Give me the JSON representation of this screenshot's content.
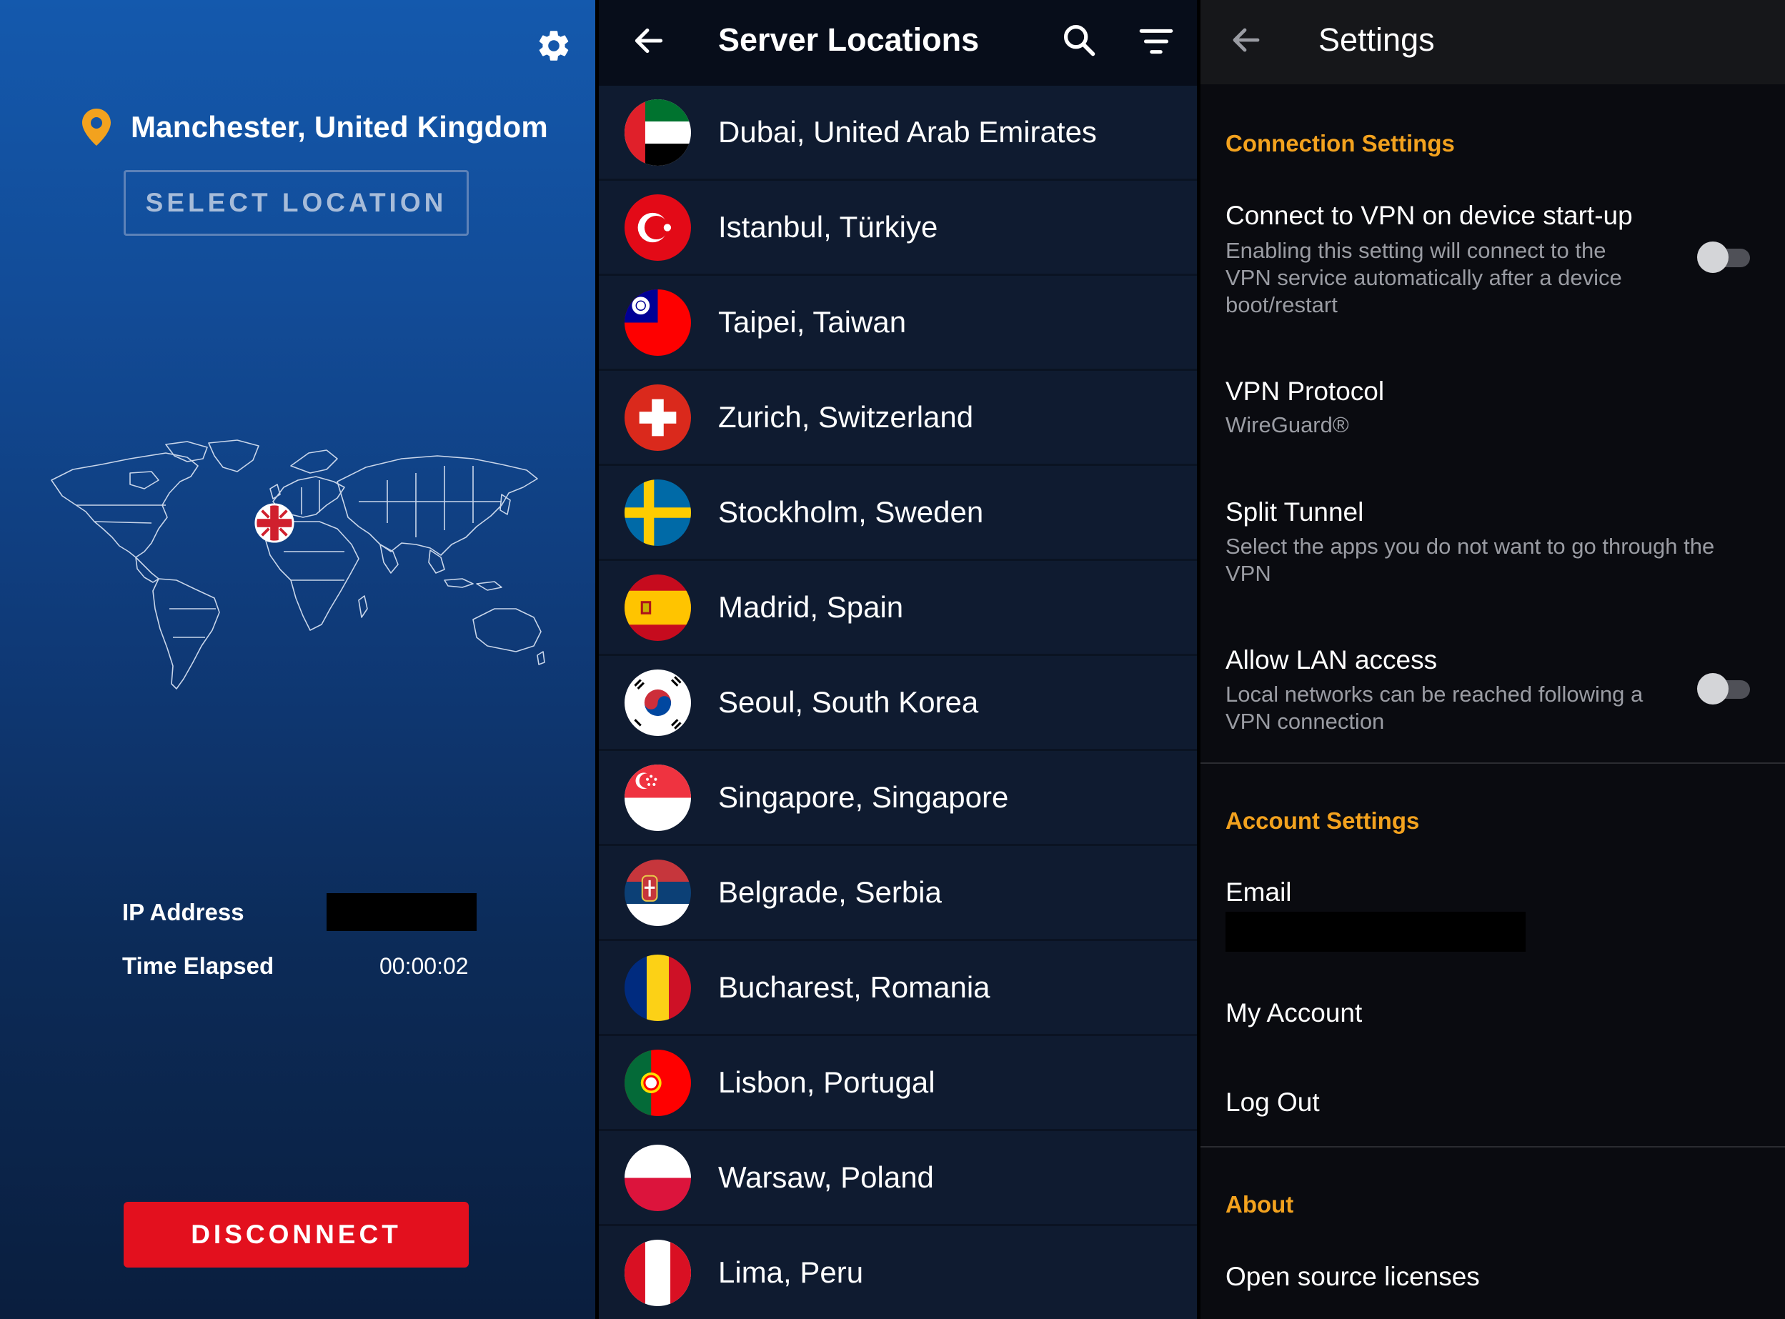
{
  "home": {
    "location": "Manchester, United Kingdom",
    "select_location": "SELECT LOCATION",
    "ip_label": "IP Address",
    "time_label": "Time Elapsed",
    "time_value": "00:00:02",
    "disconnect": "DISCONNECT",
    "colors": {
      "accent_red": "#e3101e",
      "pin": "#f3a21e"
    }
  },
  "servers": {
    "title": "Server Locations",
    "items": [
      {
        "name": "Dubai, United Arab Emirates",
        "flag": "uae-flag-icon"
      },
      {
        "name": "Istanbul, Türkiye",
        "flag": "turkey-flag-icon"
      },
      {
        "name": "Taipei, Taiwan",
        "flag": "taiwan-flag-icon"
      },
      {
        "name": "Zurich, Switzerland",
        "flag": "switzerland-flag-icon"
      },
      {
        "name": "Stockholm, Sweden",
        "flag": "sweden-flag-icon"
      },
      {
        "name": "Madrid, Spain",
        "flag": "spain-flag-icon"
      },
      {
        "name": "Seoul, South Korea",
        "flag": "south-korea-flag-icon"
      },
      {
        "name": "Singapore, Singapore",
        "flag": "singapore-flag-icon"
      },
      {
        "name": "Belgrade, Serbia",
        "flag": "serbia-flag-icon"
      },
      {
        "name": "Bucharest, Romania",
        "flag": "romania-flag-icon"
      },
      {
        "name": "Lisbon, Portugal",
        "flag": "portugal-flag-icon"
      },
      {
        "name": "Warsaw, Poland",
        "flag": "poland-flag-icon"
      },
      {
        "name": "Lima, Peru",
        "flag": "peru-flag-icon"
      }
    ]
  },
  "settings": {
    "title": "Settings",
    "connection_section": "Connection Settings",
    "startup": {
      "title": "Connect to VPN on device start-up",
      "sub": [
        "Enabling this setting will connect to the",
        "VPN service automatically after a device",
        "boot/restart"
      ],
      "enabled": false
    },
    "protocol": {
      "title": "VPN Protocol",
      "value": "WireGuard®"
    },
    "split": {
      "title": "Split Tunnel",
      "sub": [
        "Select the apps you do not want to go through the",
        "VPN"
      ]
    },
    "lan": {
      "title": "Allow LAN access",
      "sub": [
        "Local networks can be reached following a",
        "VPN connection"
      ],
      "enabled": false
    },
    "account_section": "Account Settings",
    "email_label": "Email",
    "my_account": "My Account",
    "log_out": "Log Out",
    "about_section": "About",
    "licenses": "Open source licenses",
    "colors": {
      "section": "#f3a21e"
    }
  }
}
